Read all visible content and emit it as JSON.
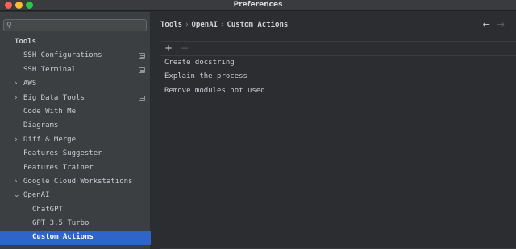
{
  "window": {
    "title": "Preferences"
  },
  "search": {
    "placeholder": ""
  },
  "sidebar": {
    "items": [
      {
        "label": "Tools",
        "type": "section"
      },
      {
        "label": "SSH Configurations",
        "project": true
      },
      {
        "label": "SSH Terminal",
        "project": true
      },
      {
        "label": "AWS",
        "expandable": true
      },
      {
        "label": "Big Data Tools",
        "expandable": true,
        "project": true
      },
      {
        "label": "Code With Me"
      },
      {
        "label": "Diagrams"
      },
      {
        "label": "Diff & Merge",
        "expandable": true
      },
      {
        "label": "Features Suggester"
      },
      {
        "label": "Features Trainer"
      },
      {
        "label": "Google Cloud Workstations",
        "expandable": true
      },
      {
        "label": "OpenAI",
        "expanded": true
      },
      {
        "label": "ChatGPT",
        "child": true
      },
      {
        "label": "GPT 3.5 Turbo",
        "child": true
      },
      {
        "label": "Custom Actions",
        "child": true,
        "selected": true
      }
    ]
  },
  "breadcrumb": {
    "parts": [
      "Tools",
      "OpenAI",
      "Custom Actions"
    ],
    "separator": "›"
  },
  "toolbar": {
    "add": "+",
    "remove": "−"
  },
  "actions": [
    "Create docstring",
    "Explain the process",
    "Remove modules not used"
  ],
  "colors": {
    "selection": "#2f65ca",
    "sidebar_bg": "#3c3f41",
    "main_bg": "#2b2d30"
  }
}
